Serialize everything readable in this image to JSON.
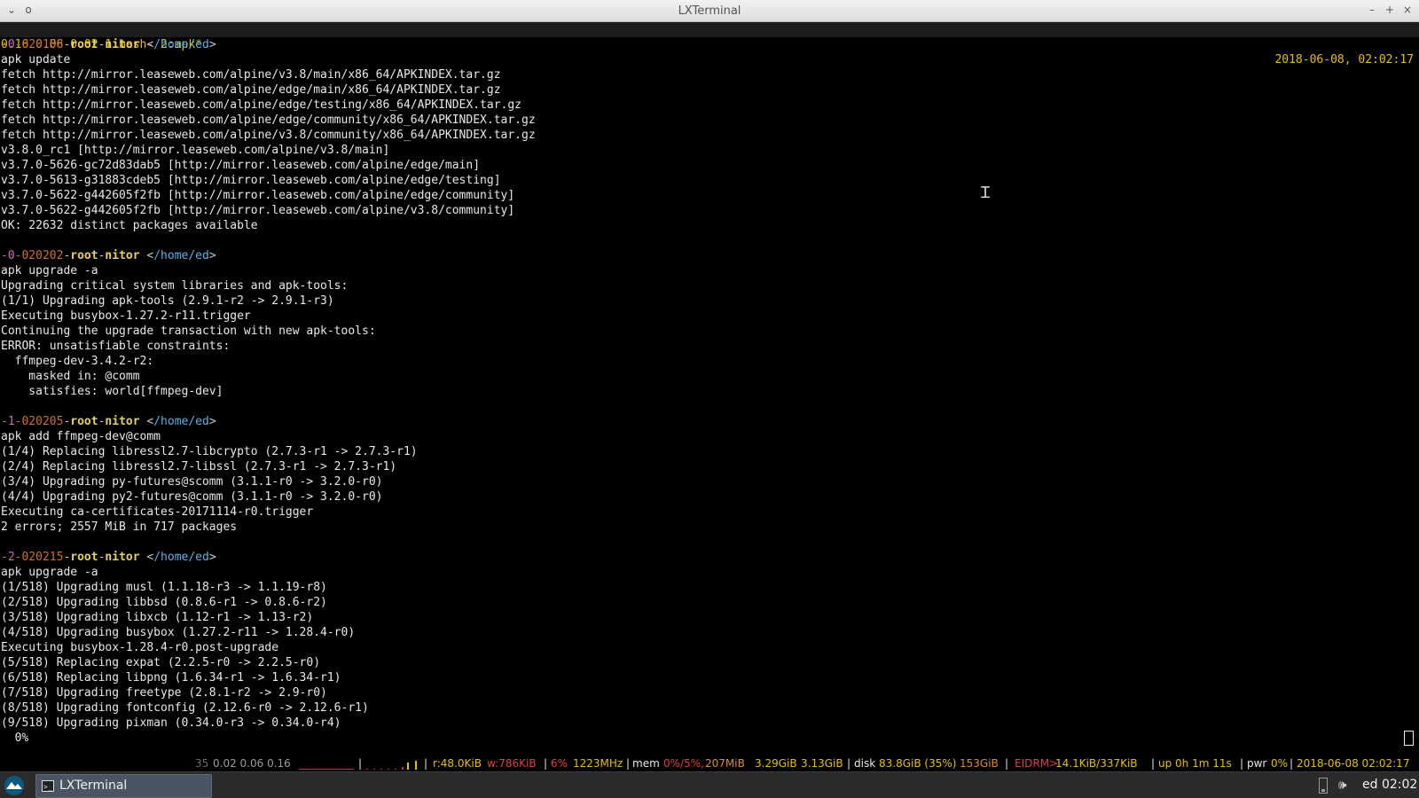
{
  "window": {
    "title": "LXTerminal",
    "buttons": {
      "menu": "⌄",
      "pin": "o",
      "minimize": "–",
      "maximize": "+",
      "close": "×"
    }
  },
  "tmux": {
    "left": "0.16 0.06 0.02 1:bash- 2:apk*",
    "right": "2018-06-08, 02:02:17"
  },
  "terminal": {
    "blocks": [
      {
        "prompt": {
          "num": "-0",
          "time": "-020158",
          "sep1": "-",
          "user": "root",
          "sep2": "-",
          "host": "nitor",
          "path_open": " <",
          "path": "/home/ed",
          "path_close": ">"
        },
        "lines": [
          "apk update",
          "fetch http://mirror.leaseweb.com/alpine/v3.8/main/x86_64/APKINDEX.tar.gz",
          "fetch http://mirror.leaseweb.com/alpine/edge/main/x86_64/APKINDEX.tar.gz",
          "fetch http://mirror.leaseweb.com/alpine/edge/testing/x86_64/APKINDEX.tar.gz",
          "fetch http://mirror.leaseweb.com/alpine/edge/community/x86_64/APKINDEX.tar.gz",
          "fetch http://mirror.leaseweb.com/alpine/v3.8/community/x86_64/APKINDEX.tar.gz",
          "v3.8.0_rc1 [http://mirror.leaseweb.com/alpine/v3.8/main]",
          "v3.7.0-5626-gc72d83dab5 [http://mirror.leaseweb.com/alpine/edge/main]",
          "v3.7.0-5613-g31883cdeb5 [http://mirror.leaseweb.com/alpine/edge/testing]",
          "v3.7.0-5622-g442605f2fb [http://mirror.leaseweb.com/alpine/edge/community]",
          "v3.7.0-5622-g442605f2fb [http://mirror.leaseweb.com/alpine/v3.8/community]",
          "OK: 22632 distinct packages available",
          ""
        ]
      },
      {
        "prompt": {
          "num": "-0",
          "time": "-020202",
          "sep1": "-",
          "user": "root",
          "sep2": "-",
          "host": "nitor",
          "path_open": " <",
          "path": "/home/ed",
          "path_close": ">"
        },
        "lines": [
          "apk upgrade -a",
          "Upgrading critical system libraries and apk-tools:",
          "(1/1) Upgrading apk-tools (2.9.1-r2 -> 2.9.1-r3)",
          "Executing busybox-1.27.2-r11.trigger",
          "Continuing the upgrade transaction with new apk-tools:",
          "ERROR: unsatisfiable constraints:",
          "  ffmpeg-dev-3.4.2-r2:",
          "    masked in: @comm",
          "    satisfies: world[ffmpeg-dev]",
          ""
        ]
      },
      {
        "prompt": {
          "num": "-1",
          "time": "-020205",
          "sep1": "-",
          "user": "root",
          "sep2": "-",
          "host": "nitor",
          "path_open": " <",
          "path": "/home/ed",
          "path_close": ">"
        },
        "lines": [
          "apk add ffmpeg-dev@comm",
          "(1/4) Replacing libressl2.7-libcrypto (2.7.3-r1 -> 2.7.3-r1)",
          "(2/4) Replacing libressl2.7-libssl (2.7.3-r1 -> 2.7.3-r1)",
          "(3/4) Upgrading py-futures@scomm (3.1.1-r0 -> 3.2.0-r0)",
          "(4/4) Upgrading py2-futures@comm (3.1.1-r0 -> 3.2.0-r0)",
          "Executing ca-certificates-20171114-r0.trigger",
          "2 errors; 2557 MiB in 717 packages",
          ""
        ]
      },
      {
        "prompt": {
          "num": "-2",
          "time": "-020215",
          "sep1": "-",
          "user": "root",
          "sep2": "-",
          "host": "nitor",
          "path_open": " <",
          "path": "/home/ed",
          "path_close": ">"
        },
        "lines": [
          "apk upgrade -a",
          "(1/518) Upgrading musl (1.1.18-r3 -> 1.1.19-r8)",
          "(2/518) Upgrading libbsd (0.8.6-r1 -> 0.8.6-r2)",
          "(3/518) Upgrading libxcb (1.12-r1 -> 1.13-r2)",
          "(4/518) Upgrading busybox (1.27.2-r11 -> 1.28.4-r0)",
          "Executing busybox-1.28.4-r0.post-upgrade",
          "(5/518) Replacing expat (2.2.5-r0 -> 2.2.5-r0)",
          "(6/518) Replacing libpng (1.6.34-r1 -> 1.6.34-r1)",
          "(7/518) Upgrading freetype (2.8.1-r2 -> 2.9-r0)",
          "(8/518) Upgrading fontconfig (2.12.6-r0 -> 2.12.6-r1)",
          "(9/518) Upgrading pixman (0.34.0-r3 -> 0.34.0-r4)",
          "  0%"
        ]
      }
    ]
  },
  "conky": {
    "load_dim": "35",
    "load": "0.02 0.06 0.16",
    "sep1": "|",
    "sep2": "|",
    "io_r": "r:48.0KiB",
    "io_w": "w:786KiB",
    "sep3": "|",
    "cpu_pct": "6%",
    "cpu_freq": "1223MHz",
    "sep4": "|",
    "mem_label": "mem",
    "mem_pct": "0%/5%,",
    "mem_used": "207MiB",
    "mem_a": "3.29GiB",
    "mem_b": "3.13GiB",
    "sep5": "|",
    "disk_label": "disk",
    "disk_used": "83.8GiB (35%)",
    "disk_total": "153GiB",
    "sep6": "|",
    "net_if": "EIDRM>",
    "net_rate": "14.1KiB/337KiB",
    "sep7": "|",
    "uptime": "up 0h 1m 11s",
    "sep8": "|",
    "pwr_label": "pwr",
    "pwr_pct": "0%",
    "sep9": "|",
    "datetime": "2018-06-08 02:02:17"
  },
  "taskbar": {
    "task_label": "LXTerminal",
    "clock": "ed 02:02",
    "volume_glyph": "🕪"
  },
  "colors": {
    "terminal_bg": "#000000",
    "terminal_fg": "#e8e8e8",
    "tmux_fg": "#e6c000",
    "prompt_num": "#c86cb4",
    "prompt_time": "#d07020",
    "prompt_user": "#e8d05a",
    "prompt_path": "#5ab0e8",
    "taskbar_bg": "#2b2b2b"
  }
}
